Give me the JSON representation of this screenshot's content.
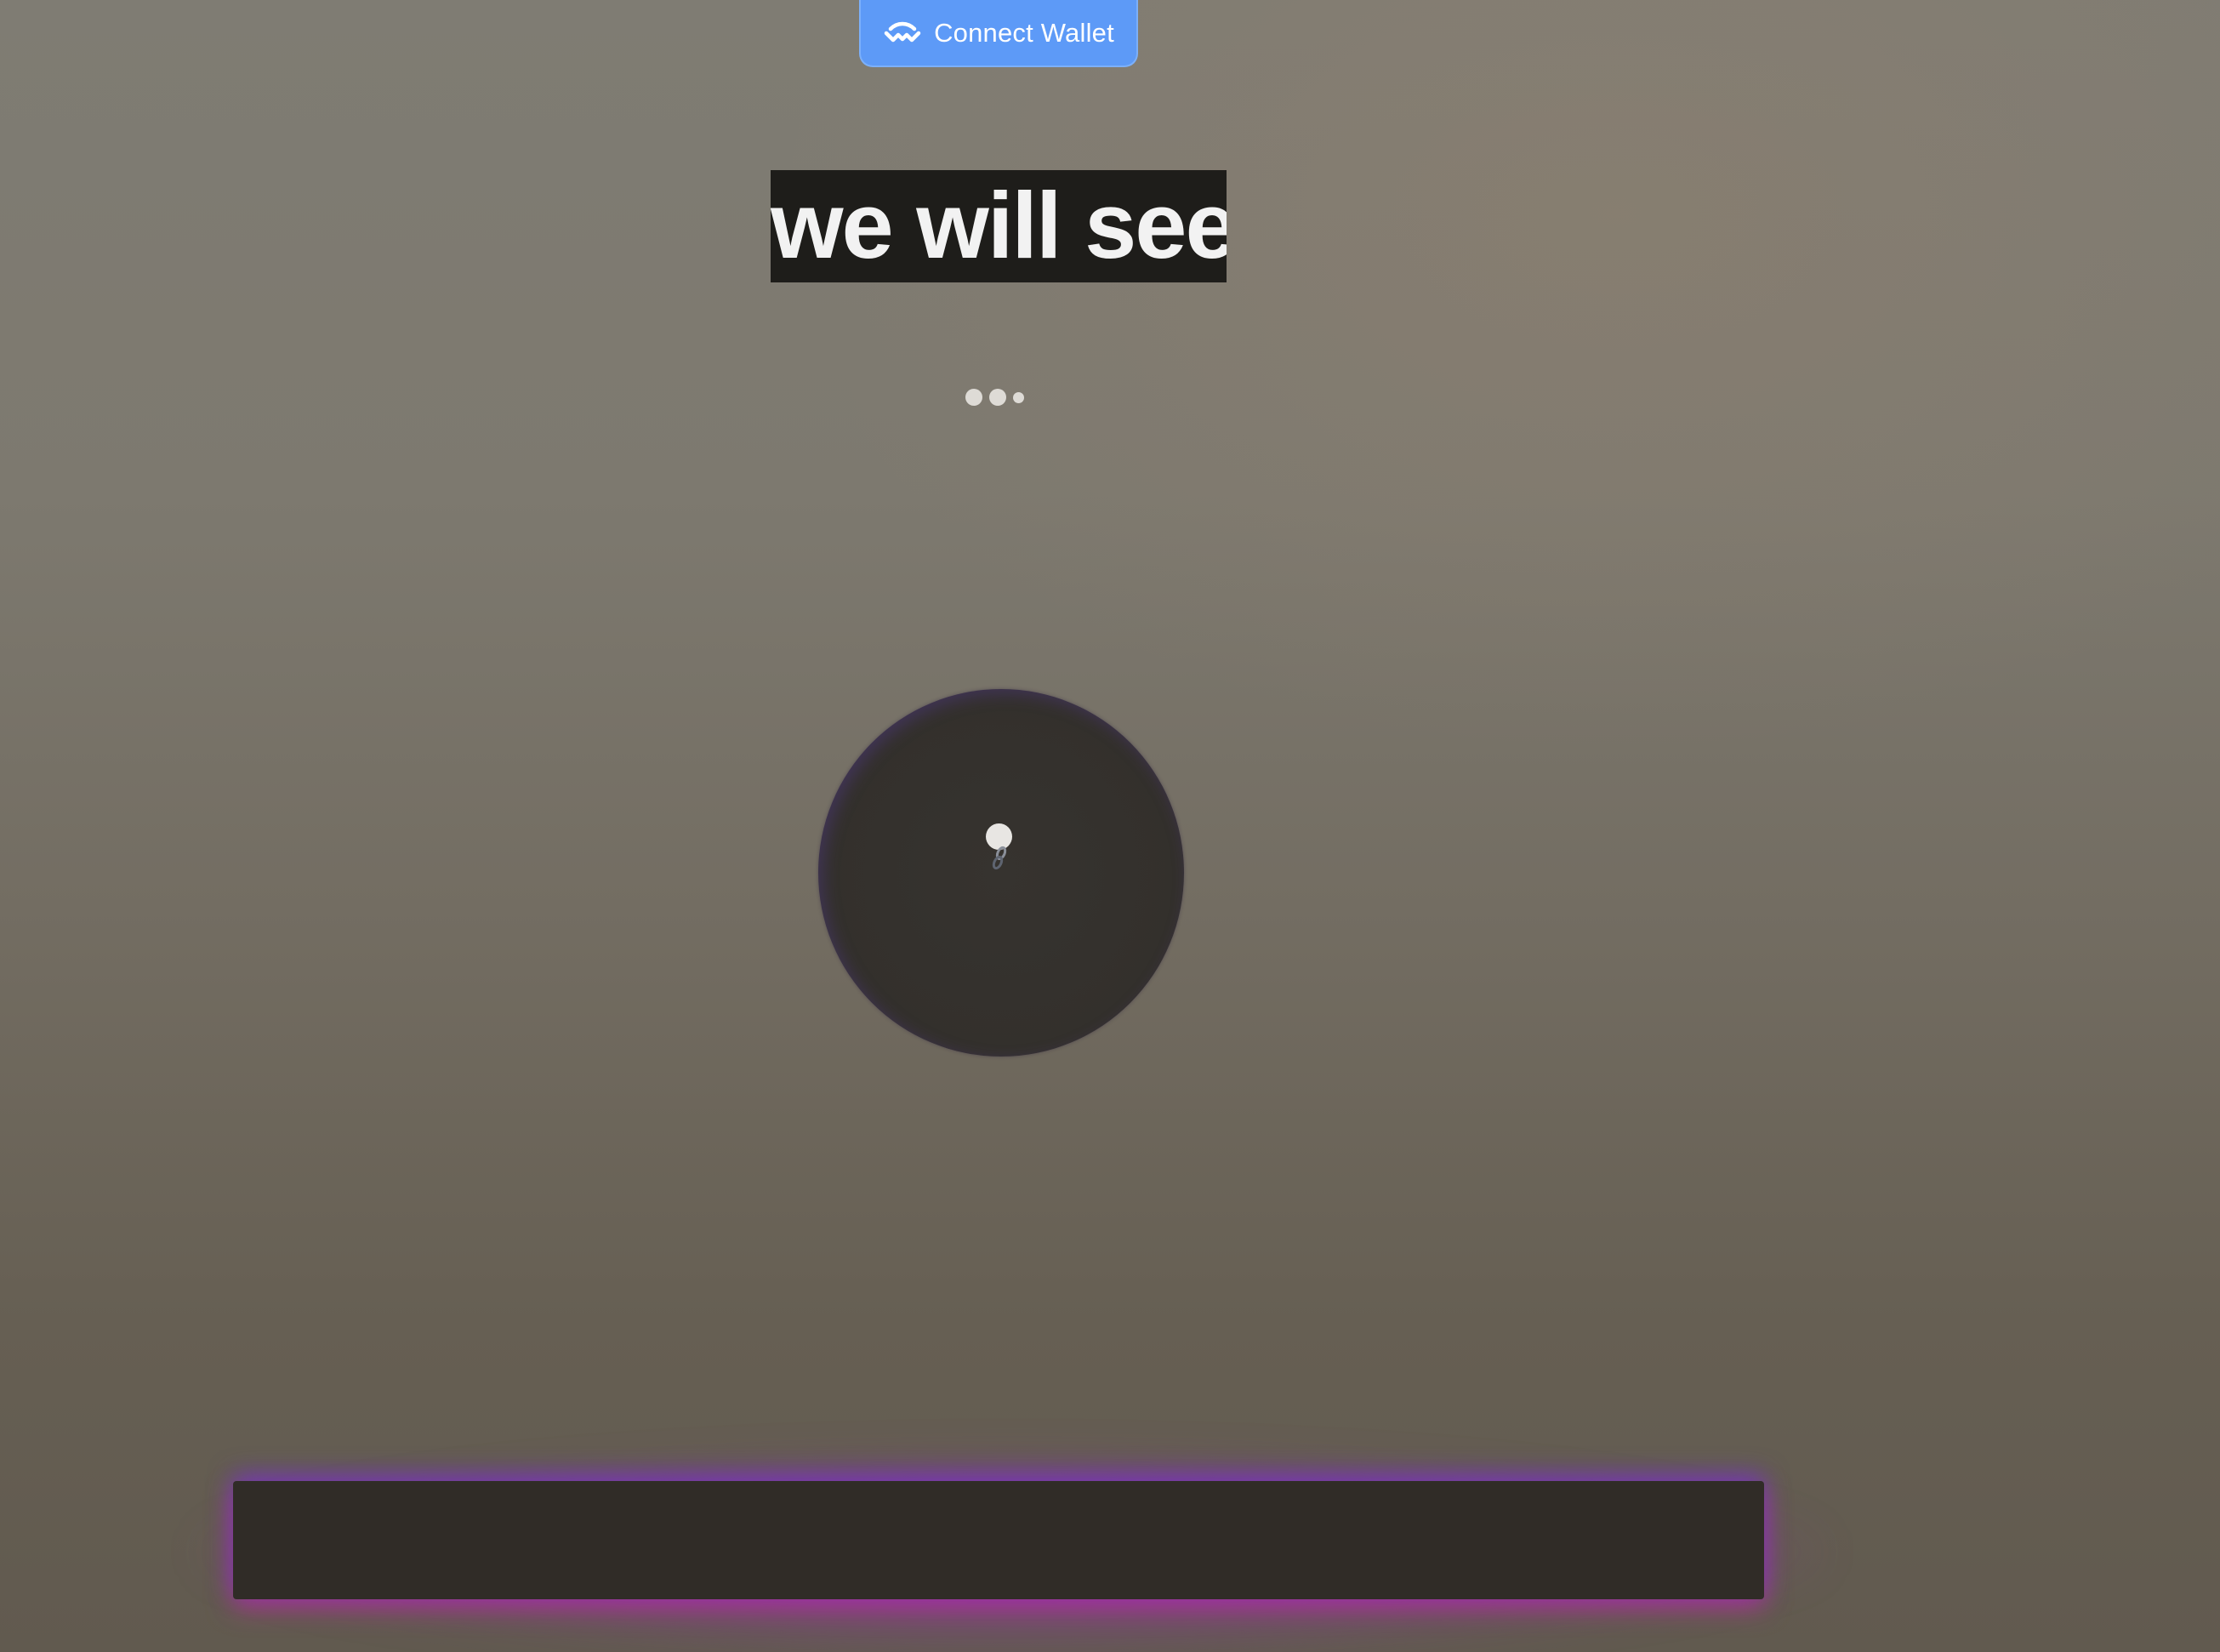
{
  "wallet_button": {
    "label": "Connect Wallet",
    "icon": "walletconnect-icon",
    "color": "#5d9af7"
  },
  "headline": {
    "text": "we will see"
  },
  "loading_indicator": {
    "icon": "ellipsis-loading-icon"
  },
  "player": {
    "icon": "link-icon"
  },
  "input_bar": {
    "value": "",
    "placeholder": "",
    "glow_colors": [
      "#7a36c8",
      "#b02a9a"
    ]
  },
  "colors": {
    "background": "#7d796f",
    "headline_background": "#1e1d1a",
    "orb": "#33302c",
    "bar": "#302c27"
  }
}
